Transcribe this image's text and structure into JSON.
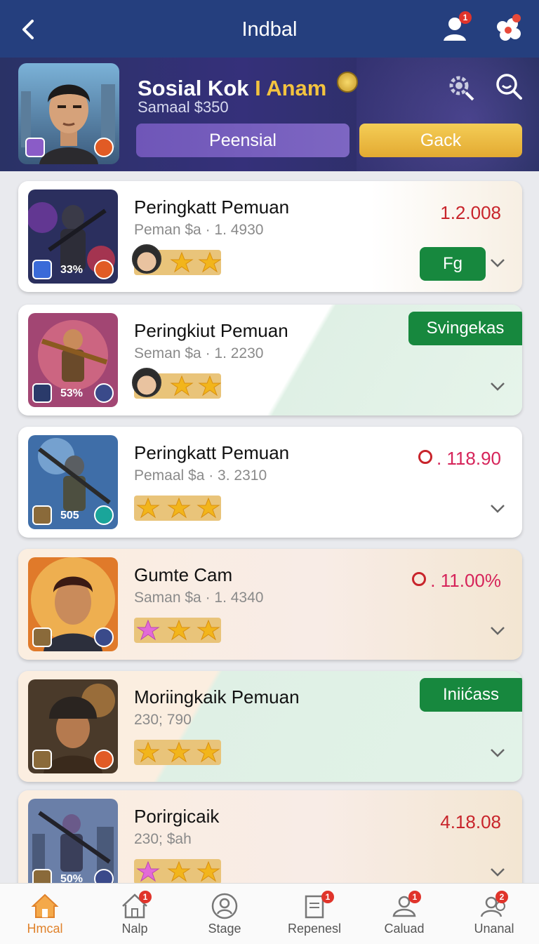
{
  "topbar": {
    "title": "Indbal",
    "notification_badge": "1"
  },
  "profile": {
    "name_part1": "Sosial Kok",
    "name_separator": "I",
    "name_part2": "Anam",
    "subtitle": "Samaal $350",
    "primary_button": "Peensial",
    "secondary_button": "Gack"
  },
  "list": [
    {
      "title": "Peringkatt Pemuan",
      "subtitle": "Peman $a · 1. 4930",
      "value": "1.2.008",
      "thumb_label": "33%",
      "action": "Fg"
    },
    {
      "title": "Peringkiut Pemuan",
      "subtitle": "Seman $a · 1. 2230",
      "value": "",
      "thumb_label": "53%",
      "action": "Svingekas"
    },
    {
      "title": "Peringkatt Pemuan",
      "subtitle": "Pemaal $a · 3. 2310",
      "value": "0. 118.90",
      "thumb_label": "505",
      "action": ""
    },
    {
      "title": "Gumte Cam",
      "subtitle": "Saman $a · 1. 4340",
      "value": "0. 11.00%",
      "thumb_label": "",
      "action": ""
    },
    {
      "title": "Moriingkaik Pemuan",
      "subtitle": "230; 790",
      "value": "",
      "thumb_label": "",
      "action": "Iniićass"
    },
    {
      "title": "Porirgicaik",
      "subtitle": "230; $ah",
      "value": "4.18.08",
      "thumb_label": "50%",
      "action": ""
    }
  ],
  "bottom_nav": [
    {
      "label": "Hmcal",
      "active": true,
      "badge": ""
    },
    {
      "label": "Nalp",
      "active": false,
      "badge": "1"
    },
    {
      "label": "Stage",
      "active": false,
      "badge": ""
    },
    {
      "label": "Repenesl",
      "active": false,
      "badge": "1"
    },
    {
      "label": "Caluad",
      "active": false,
      "badge": "1"
    },
    {
      "label": "Unanal",
      "active": false,
      "badge": "2"
    }
  ],
  "colors": {
    "topbar": "#253f7e",
    "accent_gold": "#f3c33f",
    "action_green": "#17883e",
    "value_red": "#c8242b",
    "nav_active": "#e0822b"
  },
  "icons": [
    "back-arrow-icon",
    "user-icon",
    "flower-icon",
    "gear-search-icon",
    "search-icon",
    "chevron-down-icon",
    "home-icon",
    "house-icon",
    "person-circle-icon",
    "document-icon",
    "user-bubble-icon",
    "group-icon"
  ]
}
